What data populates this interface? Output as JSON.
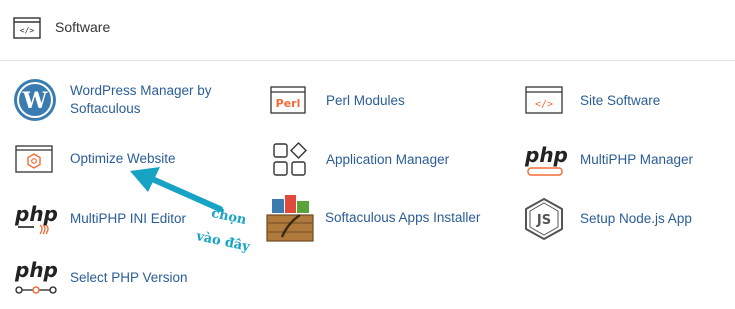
{
  "section": {
    "title": "Software",
    "icon": "code-brackets-icon"
  },
  "items": [
    {
      "label": "WordPress Manager by Softaculous",
      "icon": "wordpress-icon"
    },
    {
      "label": "Perl Modules",
      "icon": "perl-icon",
      "icon_text": "Perl"
    },
    {
      "label": "Site Software",
      "icon": "code-window-icon"
    },
    {
      "label": "Optimize Website",
      "icon": "optimize-gauge-icon"
    },
    {
      "label": "Application Manager",
      "icon": "application-grid-icon"
    },
    {
      "label": "MultiPHP Manager",
      "icon": "php-manager-icon",
      "icon_text": "php"
    },
    {
      "label": "MultiPHP INI Editor",
      "icon": "php-ini-icon",
      "icon_text": "php"
    },
    {
      "label": "Softaculous Apps Installer",
      "icon": "softaculous-box-icon"
    },
    {
      "label": "Setup Node.js App",
      "icon": "nodejs-icon",
      "icon_text": "JS"
    },
    {
      "label": "Select PHP Version",
      "icon": "php-version-icon",
      "icon_text": "php"
    }
  ],
  "annotation": {
    "line1": "chọn",
    "line2": "vào đây",
    "color": "#17a3c4"
  },
  "colors": {
    "link": "#2a5d96",
    "accent": "#f26b35",
    "border": "#e3e3e3"
  }
}
